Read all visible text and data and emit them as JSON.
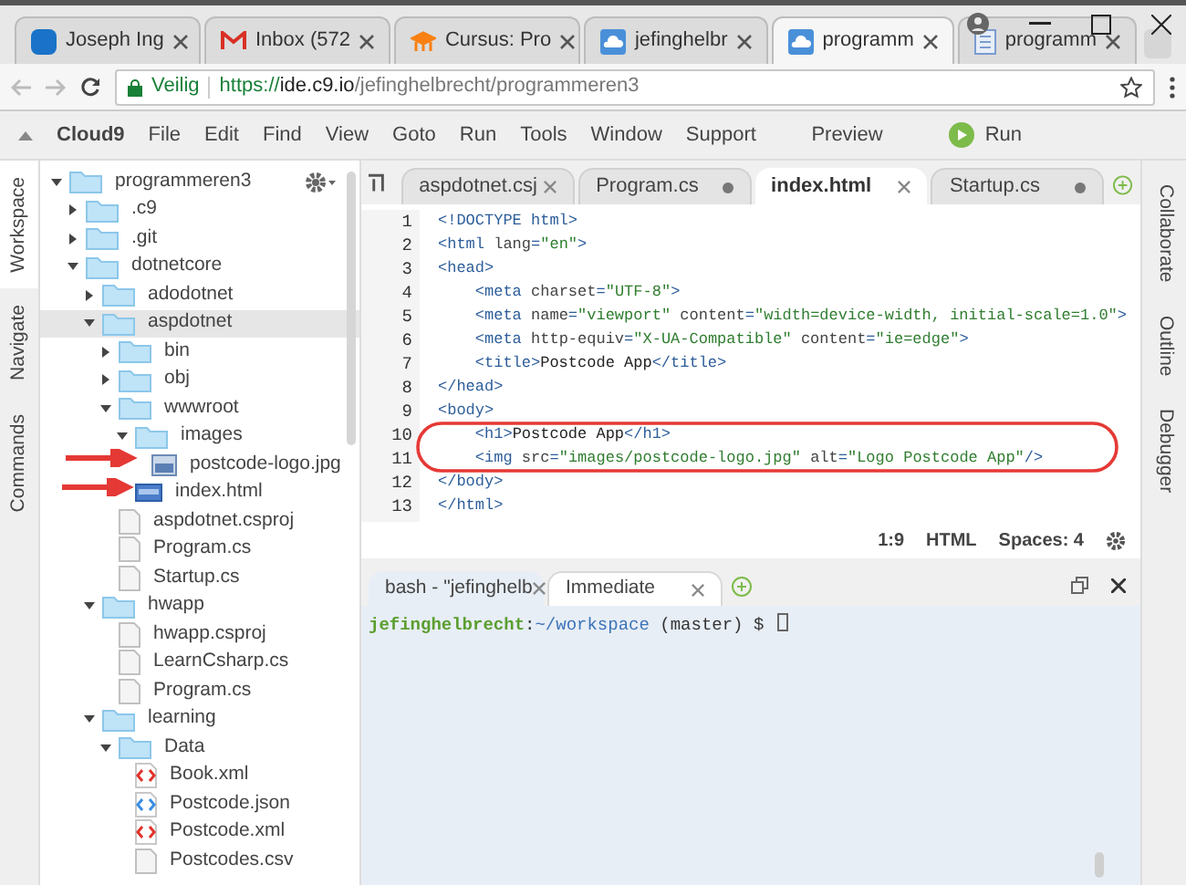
{
  "browser": {
    "tabs": [
      {
        "title": "Joseph Ing",
        "kind": "mail",
        "selected": false
      },
      {
        "title": "Inbox (572",
        "kind": "envelope",
        "selected": false
      },
      {
        "title": "Cursus: Pro",
        "kind": "course",
        "selected": false
      },
      {
        "title": "jefinghelbr",
        "kind": "cloud",
        "selected": false
      },
      {
        "title": "programm",
        "kind": "cloud",
        "selected": true
      },
      {
        "title": "programm",
        "kind": "document",
        "selected": false
      }
    ],
    "secure_label": "Veilig",
    "url_scheme": "https://",
    "url_host": "ide.c9.io",
    "url_path": "/jefinghelbrecht/programmeren3"
  },
  "menu": {
    "brand": "Cloud9",
    "items": [
      "File",
      "Edit",
      "Find",
      "View",
      "Goto",
      "Run",
      "Tools",
      "Window",
      "Support"
    ],
    "preview": "Preview",
    "run": "Run"
  },
  "left_panels": [
    {
      "label": "Workspace",
      "selected": true
    },
    {
      "label": "Navigate",
      "selected": false
    },
    {
      "label": "Commands",
      "selected": false
    }
  ],
  "right_panels": [
    {
      "label": "Collaborate",
      "selected": false
    },
    {
      "label": "Outline",
      "selected": false
    },
    {
      "label": "Debugger",
      "selected": false
    }
  ],
  "tree": [
    {
      "name": "programmeren3",
      "kind": "folder",
      "expanded": true,
      "selected": false,
      "children": [
        {
          "name": ".c9",
          "kind": "folder",
          "expanded": false,
          "selected": false
        },
        {
          "name": ".git",
          "kind": "folder",
          "expanded": false,
          "selected": false
        },
        {
          "name": "dotnetcore",
          "kind": "folder",
          "expanded": true,
          "selected": false,
          "children": [
            {
              "name": "adodotnet",
              "kind": "folder",
              "expanded": false,
              "selected": false
            },
            {
              "name": "aspdotnet",
              "kind": "folder",
              "expanded": true,
              "selected": true,
              "children": [
                {
                  "name": "bin",
                  "kind": "folder",
                  "expanded": false,
                  "selected": false
                },
                {
                  "name": "obj",
                  "kind": "folder",
                  "expanded": false,
                  "selected": false
                },
                {
                  "name": "wwwroot",
                  "kind": "folder",
                  "expanded": true,
                  "selected": false,
                  "children": [
                    {
                      "name": "images",
                      "kind": "folder",
                      "expanded": true,
                      "selected": false,
                      "children": [
                        {
                          "name": "postcode-logo.jpg",
                          "kind": "image",
                          "selected": false
                        }
                      ]
                    },
                    {
                      "name": "index.html",
                      "kind": "html",
                      "selected": false
                    }
                  ]
                },
                {
                  "name": "aspdotnet.csproj",
                  "kind": "file",
                  "selected": false
                },
                {
                  "name": "Program.cs",
                  "kind": "file",
                  "selected": false
                },
                {
                  "name": "Startup.cs",
                  "kind": "file",
                  "selected": false
                }
              ]
            },
            {
              "name": "hwapp",
              "kind": "folder",
              "expanded": true,
              "selected": false,
              "children": [
                {
                  "name": "hwapp.csproj",
                  "kind": "file",
                  "selected": false
                },
                {
                  "name": "LearnCsharp.cs",
                  "kind": "file",
                  "selected": false
                },
                {
                  "name": "Program.cs",
                  "kind": "file",
                  "selected": false
                }
              ]
            },
            {
              "name": "learning",
              "kind": "folder",
              "expanded": true,
              "selected": false,
              "children": [
                {
                  "name": "Data",
                  "kind": "folder",
                  "expanded": true,
                  "selected": false,
                  "children": [
                    {
                      "name": "Book.xml",
                      "kind": "xml",
                      "selected": false
                    },
                    {
                      "name": "Postcode.json",
                      "kind": "json",
                      "selected": false
                    },
                    {
                      "name": "Postcode.xml",
                      "kind": "xml",
                      "selected": false
                    },
                    {
                      "name": "Postcodes.csv",
                      "kind": "file",
                      "selected": false
                    }
                  ]
                }
              ]
            }
          ]
        }
      ]
    }
  ],
  "editor_tabs": [
    {
      "label": "aspdotnet.csj",
      "selected": false,
      "modified": false
    },
    {
      "label": "Program.cs",
      "selected": false,
      "modified": true
    },
    {
      "label": "index.html",
      "selected": true,
      "modified": false
    },
    {
      "label": "Startup.cs",
      "selected": false,
      "modified": true
    }
  ],
  "code": [
    {
      "number": "1",
      "tokens": [
        {
          "kind": "tag",
          "text": "<!DOCTYPE html>"
        }
      ]
    },
    {
      "number": "2",
      "tokens": [
        {
          "kind": "tag",
          "text": "<html "
        },
        {
          "kind": "attr",
          "text": "lang"
        },
        {
          "kind": "tag",
          "text": "="
        },
        {
          "kind": "str",
          "text": "\"en\""
        },
        {
          "kind": "tag",
          "text": ">"
        }
      ]
    },
    {
      "number": "3",
      "tokens": [
        {
          "kind": "tag",
          "text": "<head>"
        }
      ]
    },
    {
      "number": "4",
      "tokens": [
        {
          "kind": "tag",
          "text": "    <meta "
        },
        {
          "kind": "attr",
          "text": "charset"
        },
        {
          "kind": "tag",
          "text": "="
        },
        {
          "kind": "str",
          "text": "\"UTF-8\""
        },
        {
          "kind": "tag",
          "text": ">"
        }
      ]
    },
    {
      "number": "5",
      "tokens": [
        {
          "kind": "tag",
          "text": "    <meta "
        },
        {
          "kind": "attr",
          "text": "name"
        },
        {
          "kind": "tag",
          "text": "="
        },
        {
          "kind": "str",
          "text": "\"viewport\""
        },
        {
          "kind": "attr",
          "text": " content"
        },
        {
          "kind": "tag",
          "text": "="
        },
        {
          "kind": "str",
          "text": "\"width=device-width, initial-scale=1.0\""
        },
        {
          "kind": "tag",
          "text": ">"
        }
      ]
    },
    {
      "number": "6",
      "tokens": [
        {
          "kind": "tag",
          "text": "    <meta "
        },
        {
          "kind": "attr",
          "text": "http-equiv"
        },
        {
          "kind": "tag",
          "text": "="
        },
        {
          "kind": "str",
          "text": "\"X-UA-Compatible\""
        },
        {
          "kind": "attr",
          "text": " content"
        },
        {
          "kind": "tag",
          "text": "="
        },
        {
          "kind": "str",
          "text": "\"ie=edge\""
        },
        {
          "kind": "tag",
          "text": ">"
        }
      ]
    },
    {
      "number": "7",
      "tokens": [
        {
          "kind": "tag",
          "text": "    <title>"
        },
        {
          "kind": "text",
          "text": "Postcode App"
        },
        {
          "kind": "tag",
          "text": "</title>"
        }
      ]
    },
    {
      "number": "8",
      "tokens": [
        {
          "kind": "tag",
          "text": "</head>"
        }
      ]
    },
    {
      "number": "9",
      "tokens": [
        {
          "kind": "tag",
          "text": "<body>"
        }
      ]
    },
    {
      "number": "10",
      "tokens": [
        {
          "kind": "tag",
          "text": "    <h1>"
        },
        {
          "kind": "text",
          "text": "Postcode App"
        },
        {
          "kind": "tag",
          "text": "</h1>"
        }
      ]
    },
    {
      "number": "11",
      "tokens": [
        {
          "kind": "tag",
          "text": "    <img "
        },
        {
          "kind": "attr",
          "text": "src"
        },
        {
          "kind": "tag",
          "text": "="
        },
        {
          "kind": "str",
          "text": "\"images/postcode-logo.jpg\""
        },
        {
          "kind": "attr",
          "text": " alt"
        },
        {
          "kind": "tag",
          "text": "="
        },
        {
          "kind": "str",
          "text": "\"Logo Postcode App\""
        },
        {
          "kind": "tag",
          "text": "/>"
        }
      ]
    },
    {
      "number": "12",
      "tokens": [
        {
          "kind": "tag",
          "text": "</body>"
        }
      ]
    },
    {
      "number": "13",
      "tokens": [
        {
          "kind": "tag",
          "text": "</html>"
        }
      ]
    }
  ],
  "status": {
    "position": "1:9",
    "mode": "HTML",
    "spaces": "Spaces: 4"
  },
  "terminal_tabs": [
    {
      "label": "bash - \"jefinghelb",
      "selected": true
    },
    {
      "label": "Immediate",
      "selected": false
    }
  ],
  "prompt": {
    "user": "jefinghelbrecht",
    "separator": ":",
    "path": "~/workspace",
    "rest": " (master) $"
  }
}
